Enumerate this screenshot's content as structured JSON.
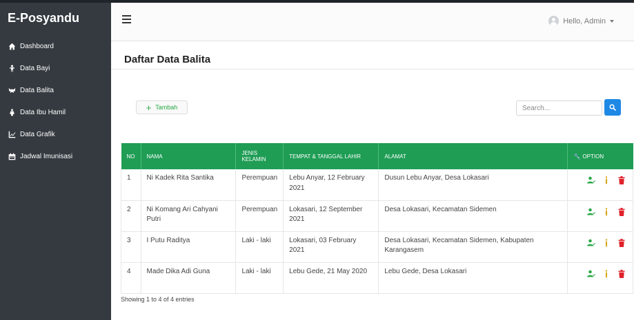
{
  "brand": "E-Posyandu",
  "sidebar": {
    "items": [
      {
        "label": "Dashboard",
        "icon": "home-icon"
      },
      {
        "label": "Data Bayi",
        "icon": "baby-icon"
      },
      {
        "label": "Data Balita",
        "icon": "child-icon"
      },
      {
        "label": "Data Ibu Hamil",
        "icon": "female-icon"
      },
      {
        "label": "Data Grafik",
        "icon": "chart-icon"
      },
      {
        "label": "Jadwal Imunisasi",
        "icon": "calendar-icon"
      }
    ]
  },
  "header": {
    "greeting": "Hello, Admin"
  },
  "page": {
    "title": "Daftar Data Balita"
  },
  "toolbar": {
    "add_label": "Tambah",
    "search_placeholder": "Search..."
  },
  "table": {
    "columns": [
      "NO",
      "NAMA",
      "JENIS KELAMIN",
      "TEMPAT & TANGGAL LAHIR",
      "ALAMAT",
      "OPTION"
    ],
    "rows": [
      {
        "no": "1",
        "nama": "Ni Kadek Rita Santika",
        "jk": "Perempuan",
        "ttl": "Lebu Anyar, 12 February 2021",
        "alamat": "Dusun Lebu Anyar, Desa Lokasari"
      },
      {
        "no": "2",
        "nama": "Ni Komang Ari Cahyani Putri",
        "jk": "Perempuan",
        "ttl": "Lokasari, 12 September 2021",
        "alamat": "Desa Lokasari, Kecamatan Sidemen"
      },
      {
        "no": "3",
        "nama": "I Putu Raditya",
        "jk": "Laki - laki",
        "ttl": "Lokasari, 03 February 2021",
        "alamat": "Desa Lokasari, Kecamatan Sidemen, Kabupaten Karangasem"
      },
      {
        "no": "4",
        "nama": "Made Dika Adi Guna",
        "jk": "Laki - laki",
        "ttl": "Lebu Gede, 21 May 2020",
        "alamat": "Lebu Gede, Desa Lokasari"
      }
    ]
  },
  "footer": {
    "entries": "Showing 1 to 4 of 4 entries"
  },
  "colors": {
    "sidebar": "#343a40",
    "table_header": "#1f9d55",
    "search_button": "#1e88e5",
    "delete": "#e0222b"
  }
}
